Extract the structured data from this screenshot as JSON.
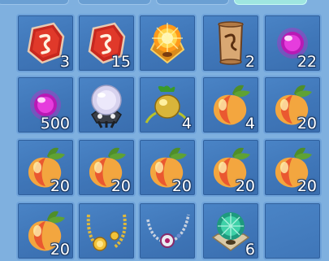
{
  "inventory": {
    "rows": [
      [
        {
          "item": "red-rune-stone",
          "icon": "red-rune-stone-icon",
          "qty": "3"
        },
        {
          "item": "red-rune-stone",
          "icon": "red-rune-stone-icon",
          "qty": "15"
        },
        {
          "item": "golden-emblem",
          "icon": "golden-paw-emblem-icon",
          "qty": ""
        },
        {
          "item": "scroll",
          "icon": "parchment-scroll-icon",
          "qty": "2"
        },
        {
          "item": "purple-gem",
          "icon": "purple-gem-icon",
          "qty": "22"
        }
      ],
      [
        {
          "item": "purple-gem",
          "icon": "purple-gem-icon",
          "qty": "500"
        },
        {
          "item": "crystal-ball",
          "icon": "crystal-ball-icon",
          "qty": ""
        },
        {
          "item": "golden-fruit",
          "icon": "golden-fruit-icon",
          "qty": "4"
        },
        {
          "item": "peach",
          "icon": "peach-icon",
          "qty": "4"
        },
        {
          "item": "peach",
          "icon": "peach-icon",
          "qty": "20"
        }
      ],
      [
        {
          "item": "peach",
          "icon": "peach-icon",
          "qty": "20"
        },
        {
          "item": "peach",
          "icon": "peach-icon",
          "qty": "20"
        },
        {
          "item": "peach",
          "icon": "peach-icon",
          "qty": "20"
        },
        {
          "item": "peach",
          "icon": "peach-icon",
          "qty": "20"
        },
        {
          "item": "peach",
          "icon": "peach-icon",
          "qty": "20"
        }
      ],
      [
        {
          "item": "peach",
          "icon": "peach-icon",
          "qty": "20"
        },
        {
          "item": "gold-necklace",
          "icon": "gold-necklace-icon",
          "qty": ""
        },
        {
          "item": "silver-necklace",
          "icon": "silver-necklace-icon",
          "qty": ""
        },
        {
          "item": "green-emblem",
          "icon": "green-paw-orb-icon",
          "qty": "6"
        },
        {
          "item": "empty",
          "icon": "",
          "qty": ""
        }
      ]
    ]
  },
  "colors": {
    "background": "#7fb0df",
    "slot": "#3f76b8",
    "slot_border": "#6fa3da",
    "active_tab": "#9fe6e0"
  }
}
